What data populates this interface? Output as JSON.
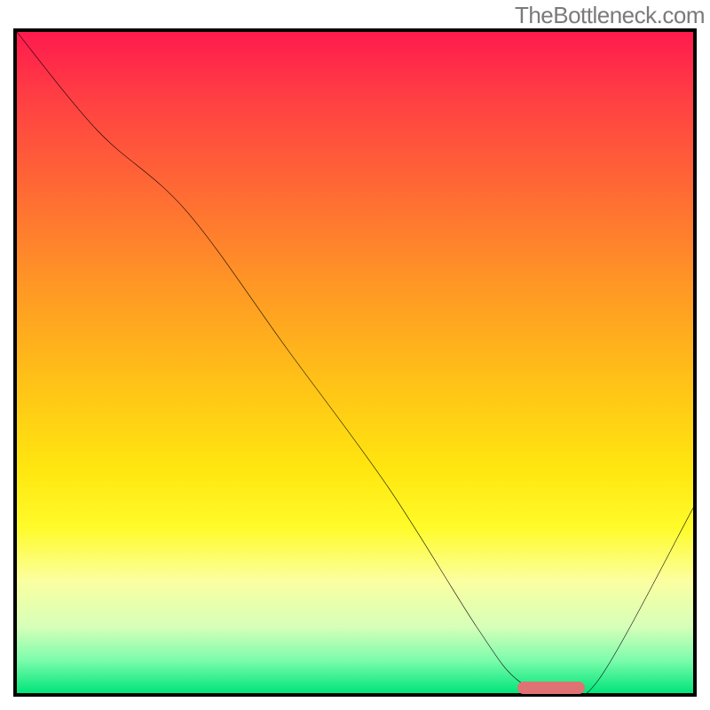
{
  "watermark": "TheBottleneck.com",
  "chart_data": {
    "type": "line",
    "title": "",
    "xlabel": "",
    "ylabel": "",
    "xlim": [
      0,
      100
    ],
    "ylim": [
      0,
      100
    ],
    "grid": false,
    "legend": false,
    "background_gradient": {
      "top_color": "#ff1a4e",
      "bottom_color": "#00e57a"
    },
    "series": [
      {
        "name": "bottleneck-curve",
        "color": "#000000",
        "x": [
          0,
          12,
          25,
          40,
          55,
          68,
          74,
          80,
          86,
          100
        ],
        "y": [
          100,
          85,
          73,
          52,
          31,
          10,
          2,
          0,
          2,
          28
        ]
      }
    ],
    "marker": {
      "name": "optimal-range",
      "color": "#df7373",
      "x_start": 74,
      "x_end": 84,
      "y": 0
    }
  }
}
